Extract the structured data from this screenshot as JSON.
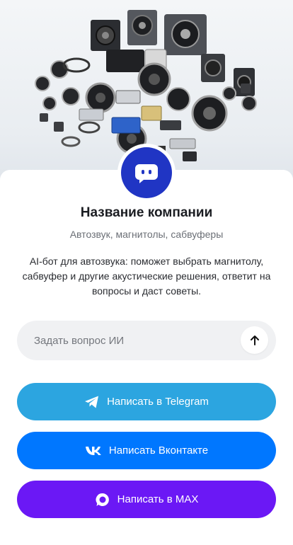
{
  "company": {
    "name": "Название компании",
    "subtitle": "Автозвук, магнитолы, сабвуферы",
    "description": "AI-бот для автозвука: поможет выбрать магнитолу, сабвуфер и другие акустические решения, ответит на вопросы и даст советы."
  },
  "hero": {
    "image_subject": "car audio equipment: speakers, subwoofers, amplifiers, cables"
  },
  "avatar": {
    "icon": "chat-bot-icon",
    "color": "#2035c4"
  },
  "ask": {
    "placeholder": "Задать вопрос ИИ",
    "send_icon": "arrow-up-icon"
  },
  "actions": [
    {
      "label": "Написать в Telegram",
      "icon": "telegram-icon",
      "color": "#2ca5e0"
    },
    {
      "label": "Написать Вконтакте",
      "icon": "vk-icon",
      "color": "#0077ff"
    },
    {
      "label": "Написать в MAX",
      "icon": "max-icon",
      "color": "#6b18f5"
    }
  ]
}
